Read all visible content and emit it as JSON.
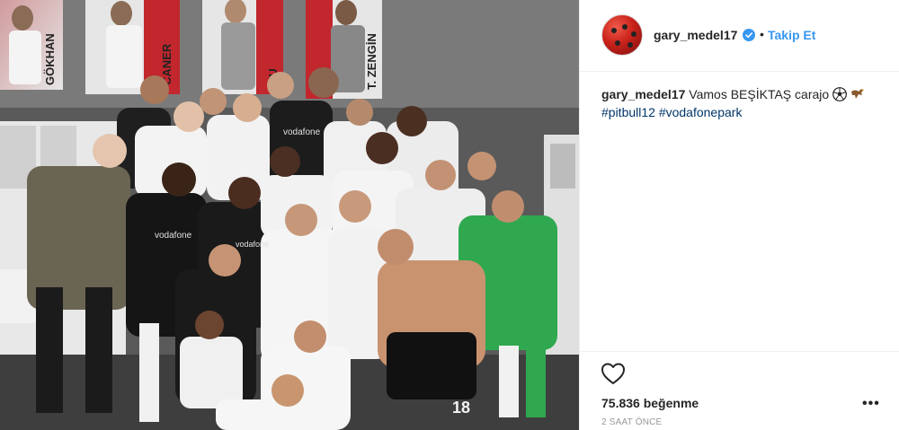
{
  "header": {
    "username": "gary_medel17",
    "separator": "•",
    "follow_label": "Takip Et",
    "verified_icon": "verified-badge-icon"
  },
  "caption": {
    "username": "gary_medel17",
    "text": "Vamos BEŞİKTAŞ carajo",
    "emojis": [
      "soccer-ball-icon",
      "eagle-icon"
    ],
    "hashtags": [
      "#pitbull12",
      "#vodafonepark"
    ]
  },
  "actions": {
    "like_icon": "heart-icon",
    "likes_text": "75.836 beğenme",
    "time_text": "2 SAAT ÖNCE",
    "more_label": "•••"
  },
  "photo": {
    "sponsor_text": "vodafone",
    "banners": [
      "GÖKHAN",
      "CANER",
      "KU",
      "T. ZENGİN"
    ],
    "jersey_number": "18"
  },
  "colors": {
    "link": "#3897f0",
    "hashtag": "#003569",
    "meta": "#999999",
    "border": "#efefef"
  }
}
